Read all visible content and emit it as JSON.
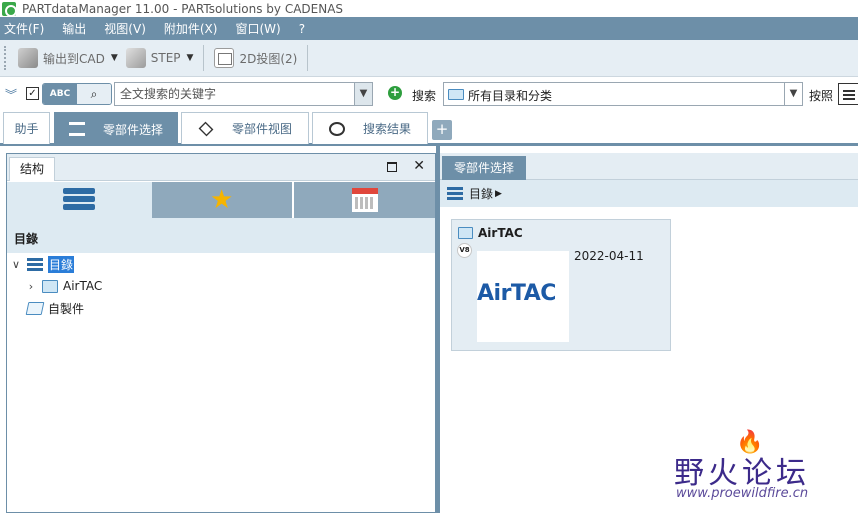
{
  "window": {
    "title": "PARTdataManager 11.00 - PARTsolutions by CADENAS"
  },
  "menu": {
    "items": [
      "文件(F)",
      "输出",
      "视图(V)",
      "附加件(X)",
      "窗口(W)",
      "?"
    ]
  },
  "toolbar": {
    "export_cad": "输出到CAD",
    "step": "STEP",
    "projection_2d": "2D投图(2)"
  },
  "search": {
    "mode_label": "ABC",
    "placeholder": "全文搜索的关键字",
    "search_label": "搜索",
    "scope_value": "所有目录和分类",
    "sort_label": "按照"
  },
  "tabs": {
    "assistant": "助手",
    "part_selection": "零部件选择",
    "part_view": "零部件视图",
    "search_results": "搜索结果"
  },
  "left_panel": {
    "tab_label": "结构",
    "section_title": "目錄",
    "tree": {
      "root": "目錄",
      "child": "AirTAC",
      "custom": "自製件"
    }
  },
  "right_panel": {
    "tab_label": "零部件选择",
    "breadcrumb": "目錄",
    "card": {
      "title": "AirTAC",
      "badge": "V8",
      "logo_text": "AirTAC",
      "date": "2022-04-11"
    }
  },
  "watermark": {
    "logo": "野火论坛",
    "url": "www.proewildfire.cn"
  },
  "colors": {
    "accent": "#6d8fa8",
    "panel_light": "#ddeaf2",
    "selection": "#2a7dd8",
    "logo_blue": "#1c5aa6"
  }
}
